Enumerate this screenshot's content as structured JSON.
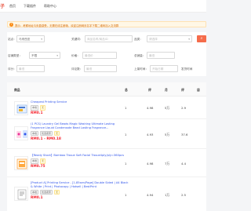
{
  "topbar": {
    "logo": "子",
    "nav": [
      "首页",
      "下载插件",
      "帮助中心"
    ]
  },
  "notice": {
    "icon": "info-icon",
    "text": "提示：考察地址与负盈感受，无需在线注册哦，欢迎注册网页名字下载二维码加入交流群"
  },
  "filters": {
    "site_label": "站点：",
    "site_value": "马来西亚",
    "keyword_label": "关键词：",
    "keyword_placeholder": "商品名称/商品ID",
    "category_label": "品类：",
    "category_placeholder": "请选择",
    "shop_type_label": "店铺类型：",
    "shop_type_value": "不限",
    "price_label": "价格：",
    "price_placeholder": "最低价",
    "sales_label": "总销量：",
    "sales_placeholder": "最低",
    "rating_label": "评分：",
    "rating_placeholder": "最低",
    "reviews_label": "评论数：",
    "reviews_placeholder": "最低",
    "listed_label": "上架时间：",
    "listed_placeholder": "开始日期",
    "ship_label": "发货时间",
    "search_icon": "search-icon",
    "accent": "#f56c4b"
  },
  "table": {
    "headers": [
      "商品",
      "总",
      "评",
      "月",
      "评",
      "店"
    ],
    "rows": [
      {
        "title": "Cheapest Printing Service",
        "tags": [
          "本地",
          "无"
        ],
        "price": "RM0.1",
        "rating": "4.98",
        "monthly": "5万",
        "reviews": "2.9",
        "col1": "1"
      },
      {
        "title": "(1 PCS) Laundry Gel Beads Magic Washing Ultimate Lasting Fragrance Liquid Condensate Bead Lasting Fragrance...",
        "tags": [
          "本地",
          "优选卖家",
          "无"
        ],
        "price": "RM0.1 - RM0.18",
        "rating": "4.93",
        "monthly": "5万",
        "reviews": "37.6",
        "col1": "1"
      },
      {
        "title": "【Ready Stock】Bamboo Tissue Soft Facial Tissue4ply/ply=360pcs",
        "tags": [
          "本地",
          "无"
        ],
        "price": "RM0.75",
        "rating": "4.98",
        "monthly": "7万",
        "reviews": "4.4",
        "col1": "1"
      },
      {
        "title": "[Product A] Printing Service - [1-85sen/Page] Double Sided | A4 Black & White | Print | Photocopy | Hotsell | BestPrint",
        "tags": [
          "本地",
          "优选卖家",
          "无"
        ],
        "price": "RM0.1",
        "rating": "4.94",
        "monthly": "1万",
        "reviews": "2.5",
        "col1": "1"
      }
    ]
  }
}
